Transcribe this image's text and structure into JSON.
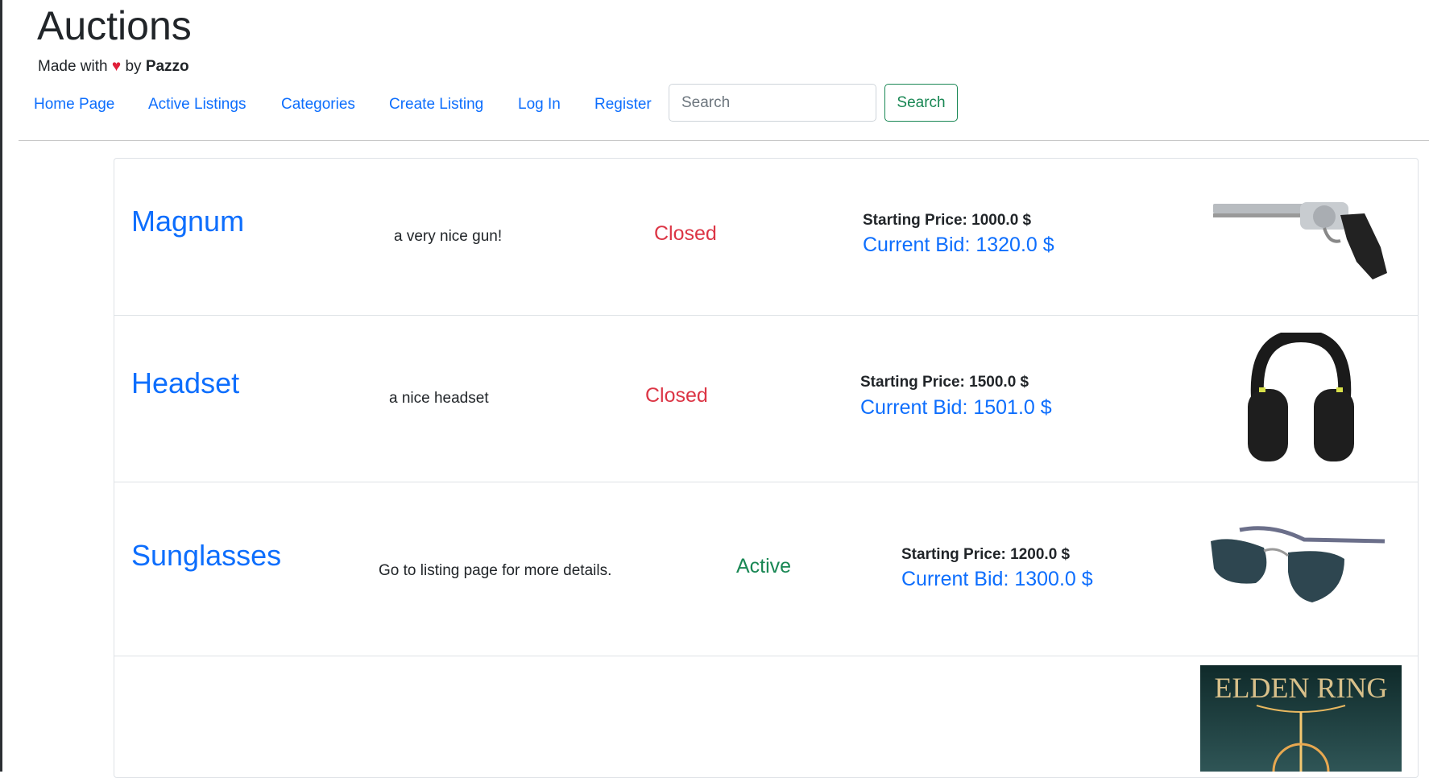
{
  "header": {
    "title": "Auctions",
    "made_with": "Made with",
    "by": "by",
    "author": "Pazzo",
    "heart_icon": "heart-icon"
  },
  "nav": {
    "items": [
      "Home Page",
      "Active Listings",
      "Categories",
      "Create Listing",
      "Log In",
      "Register"
    ],
    "search_placeholder": "Search",
    "search_button": "Search"
  },
  "listings": [
    {
      "title": "Magnum",
      "description": "a very nice gun!",
      "status": "Closed",
      "starting_price": "Starting Price: 1000.0 $",
      "current_bid": "Current Bid: 1320.0 $",
      "image": "revolver"
    },
    {
      "title": "Headset",
      "description": "a nice headset",
      "status": "Closed",
      "starting_price": "Starting Price: 1500.0 $",
      "current_bid": "Current Bid: 1501.0 $",
      "image": "headset"
    },
    {
      "title": "Sunglasses",
      "description": "Go to listing page for more details.",
      "status": "Active",
      "starting_price": "Starting Price: 1200.0 $",
      "current_bid": "Current Bid: 1300.0 $",
      "image": "sunglasses"
    },
    {
      "image": "elden-ring-cover",
      "image_text": "ELDEN RING"
    }
  ],
  "colors": {
    "link": "#0d6efd",
    "closed": "#dc3545",
    "active": "#198754"
  }
}
